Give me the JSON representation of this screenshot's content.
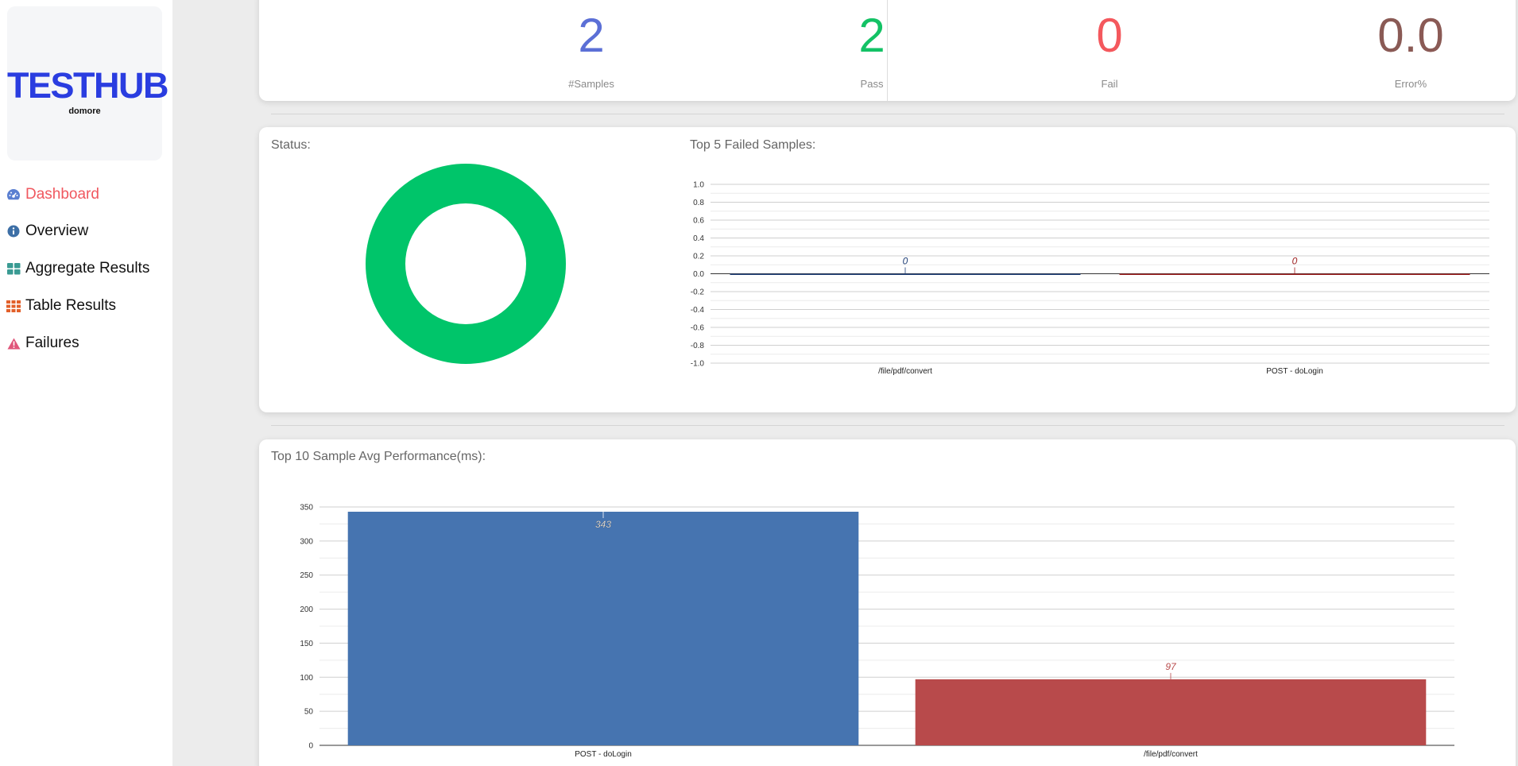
{
  "app": {
    "logo_title": "TESTHUB",
    "logo_subtitle": "domore"
  },
  "sidebar": {
    "items": [
      {
        "label": "Dashboard",
        "icon": "dashboard-icon",
        "active": true
      },
      {
        "label": "Overview",
        "icon": "info-icon",
        "active": false
      },
      {
        "label": "Aggregate Results",
        "icon": "grid-icon",
        "active": false
      },
      {
        "label": "Table Results",
        "icon": "table-icon",
        "active": false
      },
      {
        "label": "Failures",
        "icon": "warning-icon",
        "active": false
      }
    ]
  },
  "stats": [
    {
      "value": "2",
      "label": "#Samples",
      "color": "#5b6fd6"
    },
    {
      "value": "2",
      "label": "Pass",
      "color": "#13c265"
    },
    {
      "value": "0",
      "label": "Fail",
      "color": "#f4585d"
    },
    {
      "value": "0.0",
      "label": "Error%",
      "color": "#8a5a55"
    }
  ],
  "status_panel": {
    "title": "Status:"
  },
  "failed_panel": {
    "title": "Top 5 Failed Samples:"
  },
  "perf_panel": {
    "title": "Top 10 Sample Avg Performance(ms):"
  },
  "chart_data": [
    {
      "type": "pie",
      "title": "Status:",
      "slices": [
        {
          "value": 2,
          "color": "#00c56a"
        },
        {
          "value": 0
        }
      ]
    },
    {
      "type": "bar",
      "title": "Top 5 Failed Samples:",
      "categories": [
        "/file/pdf/convert",
        "POST - doLogin"
      ],
      "values": [
        0,
        0
      ],
      "colors": [
        "#1f3f77",
        "#9c1e1e"
      ],
      "ylim": [
        -1.0,
        1.0
      ],
      "yticks": [
        "1.0",
        "0.8",
        "0.6",
        "0.4",
        "0.2",
        "0.0",
        "-0.2",
        "-0.4",
        "-0.6",
        "-0.8",
        "-1.0"
      ],
      "grid": true
    },
    {
      "type": "bar",
      "title": "Top 10 Sample Avg Performance(ms):",
      "categories": [
        "POST - doLogin",
        "/file/pdf/convert"
      ],
      "values": [
        343,
        97
      ],
      "colors": [
        "#4674b0",
        "#b84a4b"
      ],
      "ylim": [
        0,
        350
      ],
      "yticks": [
        "350",
        "300",
        "250",
        "200",
        "150",
        "100",
        "50",
        "0"
      ],
      "grid": true
    }
  ]
}
